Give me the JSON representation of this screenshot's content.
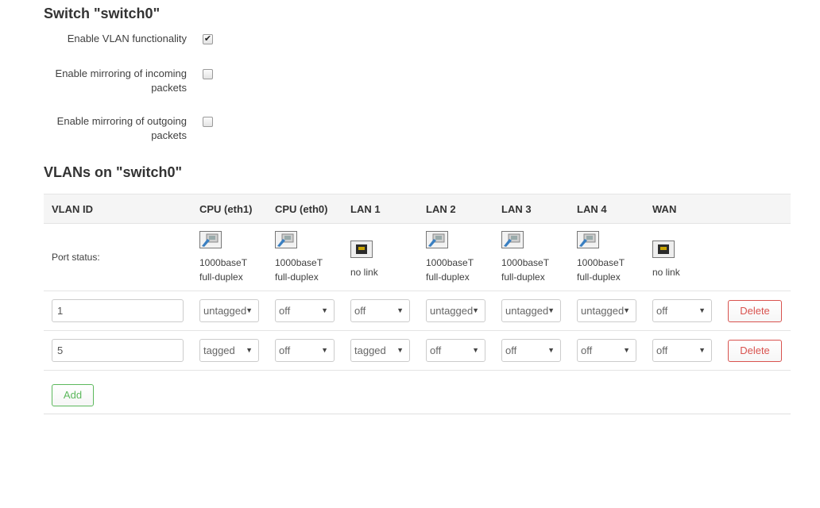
{
  "switch_section": {
    "title": "Switch \"switch0\"",
    "options": [
      {
        "label": "Enable VLAN functionality",
        "checked": true
      },
      {
        "label": "Enable mirroring of incoming packets",
        "checked": false
      },
      {
        "label": "Enable mirroring of outgoing packets",
        "checked": false
      }
    ]
  },
  "vlan_section": {
    "title": "VLANs on \"switch0\"",
    "headers": [
      "VLAN ID",
      "CPU (eth1)",
      "CPU (eth0)",
      "LAN 1",
      "LAN 2",
      "LAN 3",
      "LAN 4",
      "WAN"
    ],
    "port_status_label": "Port status:",
    "port_status": [
      {
        "icon": "port-link-icon",
        "line1": "1000baseT",
        "line2": "full-duplex"
      },
      {
        "icon": "port-link-icon",
        "line1": "1000baseT",
        "line2": "full-duplex"
      },
      {
        "icon": "port-nolink-icon",
        "line1": "no link",
        "line2": ""
      },
      {
        "icon": "port-link-icon",
        "line1": "1000baseT",
        "line2": "full-duplex"
      },
      {
        "icon": "port-link-icon",
        "line1": "1000baseT",
        "line2": "full-duplex"
      },
      {
        "icon": "port-link-icon",
        "line1": "1000baseT",
        "line2": "full-duplex"
      },
      {
        "icon": "port-nolink-icon",
        "line1": "no link",
        "line2": ""
      }
    ],
    "rows": [
      {
        "vlan_id": "1",
        "ports": [
          "untagged",
          "off",
          "off",
          "untagged",
          "untagged",
          "untagged",
          "off"
        ],
        "delete_label": "Delete"
      },
      {
        "vlan_id": "5",
        "ports": [
          "tagged",
          "off",
          "tagged",
          "off",
          "off",
          "off",
          "off"
        ],
        "delete_label": "Delete"
      }
    ],
    "add_label": "Add"
  },
  "colors": {
    "delete": "#d9534f",
    "add": "#5cb85c",
    "header_bg": "#f5f5f5"
  }
}
